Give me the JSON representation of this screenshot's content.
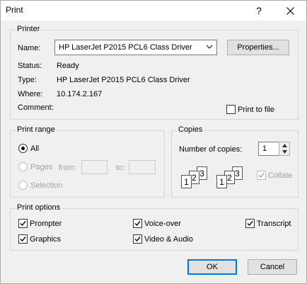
{
  "window": {
    "title": "Print",
    "help_glyph": "?",
    "close_glyph": "✕"
  },
  "printer": {
    "legend": "Printer",
    "name_label": "Name:",
    "name_value": "HP LaserJet P2015 PCL6 Class Driver",
    "properties_button": "Properties...",
    "status_label": "Status:",
    "status_value": "Ready",
    "type_label": "Type:",
    "type_value": "HP LaserJet P2015 PCL6 Class Driver",
    "where_label": "Where:",
    "where_value": "10.174.2.167",
    "comment_label": "Comment:",
    "print_to_file_label": "Print to file",
    "print_to_file_checked": false
  },
  "print_range": {
    "legend": "Print range",
    "all_label": "All",
    "pages_label": "Pages",
    "from_label": "from:",
    "to_label": "to:",
    "from_value": "",
    "to_value": "",
    "selection_label": "Selection",
    "selected": "All"
  },
  "copies": {
    "legend": "Copies",
    "number_label": "Number of copies:",
    "number_value": "1",
    "collate_label": "Collate",
    "collate_checked": true,
    "collate_enabled": false,
    "page_digits": [
      "1",
      "2",
      "3"
    ]
  },
  "print_options": {
    "legend": "Print options",
    "items": [
      {
        "label": "Prompter",
        "checked": true
      },
      {
        "label": "Voice-over",
        "checked": true
      },
      {
        "label": "Transcript",
        "checked": true
      },
      {
        "label": "Graphics",
        "checked": true
      },
      {
        "label": "Video & Audio",
        "checked": true
      }
    ]
  },
  "buttons": {
    "ok": "OK",
    "cancel": "Cancel"
  },
  "colors": {
    "accent": "#0078d7",
    "dialog_bg": "#f0f0f0",
    "disabled_text": "#a0a0a0"
  },
  "icons": {
    "checkmark": "checkmark-icon",
    "combo_arrow": "chevron-down-icon",
    "spin_up": "spin-up-icon",
    "spin_down": "spin-down-icon"
  }
}
